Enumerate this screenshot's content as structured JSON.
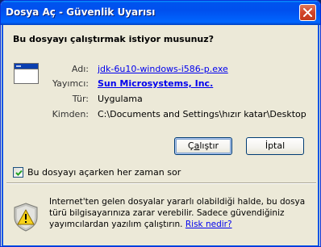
{
  "window": {
    "title": "Dosya Aç - Güvenlik Uyarısı"
  },
  "question": "Bu dosyayı çalıştırmak istiyor musunuz?",
  "file_info": {
    "name_label": "Adı:",
    "name_value": "jdk-6u10-windows-i586-p.exe",
    "publisher_label": "Yayımcı:",
    "publisher_value": "Sun Microsystems, Inc.",
    "type_label": "Tür:",
    "type_value": "Uygulama",
    "from_label": "Kimden:",
    "from_value": "C:\\Documents and Settings\\hızır katar\\Desktop"
  },
  "buttons": {
    "run_pre": "Ç",
    "run_acc": "a",
    "run_post": "lıştır",
    "cancel": "İptal"
  },
  "checkbox": {
    "label": "Bu dosyayı açarken her zaman sor",
    "checked": true
  },
  "warning": {
    "text": "Internet'ten gelen dosyalar yararlı olabildiği halde, bu dosya türü bilgisayarınıza zarar verebilir. Sadece güvendiğiniz yayımcılardan yazılım çalıştırın.",
    "link": "Risk nedir?"
  }
}
